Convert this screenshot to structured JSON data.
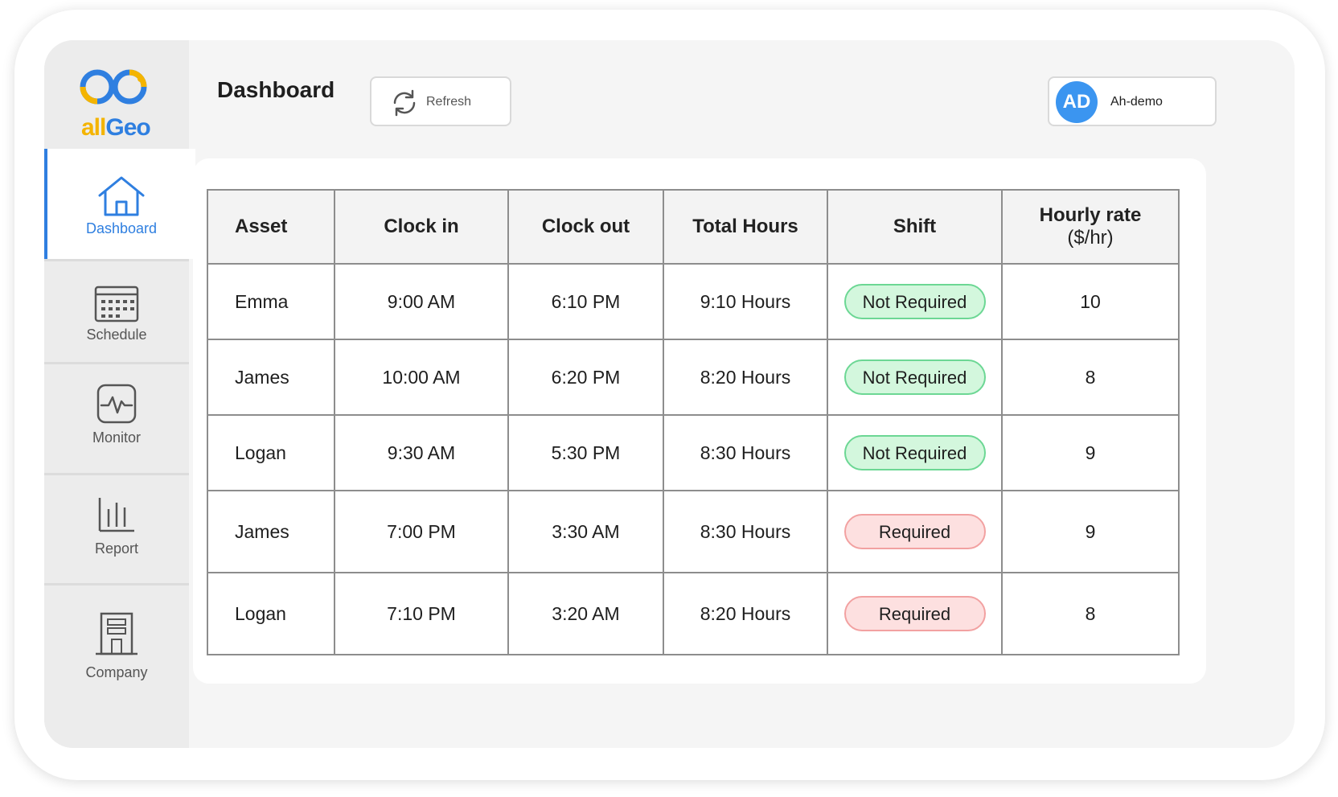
{
  "app": {
    "logo": {
      "part1": "all",
      "part2": "Geo"
    },
    "page_title": "Dashboard",
    "refresh_label": "Refresh",
    "user": {
      "initials": "AD",
      "name": "Ah-demo"
    }
  },
  "sidebar": {
    "items": [
      {
        "label": "Dashboard",
        "icon": "home-icon",
        "active": true
      },
      {
        "label": "Schedule",
        "icon": "calendar-icon",
        "active": false
      },
      {
        "label": "Monitor",
        "icon": "pulse-icon",
        "active": false
      },
      {
        "label": "Report",
        "icon": "bar-chart-icon",
        "active": false
      },
      {
        "label": "Company",
        "icon": "building-icon",
        "active": false
      }
    ]
  },
  "table": {
    "headers": [
      "Asset",
      "Clock in",
      "Clock out",
      "Total Hours",
      "Shift",
      "Hourly rate",
      "($/hr)"
    ],
    "rows": [
      {
        "asset": "Emma",
        "clock_in": "9:00 AM",
        "clock_out": "6:10 PM",
        "total": "9:10 Hours",
        "shift": "Not Required",
        "rate": "10"
      },
      {
        "asset": "James",
        "clock_in": "10:00 AM",
        "clock_out": "6:20 PM",
        "total": "8:20 Hours",
        "shift": "Not Required",
        "rate": "8"
      },
      {
        "asset": "Logan",
        "clock_in": "9:30 AM",
        "clock_out": "5:30 PM",
        "total": "8:30 Hours",
        "shift": "Not Required",
        "rate": "9"
      },
      {
        "asset": "James",
        "clock_in": "7:00 PM",
        "clock_out": "3:30 AM",
        "total": "8:30 Hours",
        "shift": "Required",
        "rate": "9"
      },
      {
        "asset": "Logan",
        "clock_in": "7:10 PM",
        "clock_out": "3:20 AM",
        "total": "8:20 Hours",
        "shift": "Required",
        "rate": "8"
      }
    ]
  },
  "colors": {
    "accent": "#2f7fe0",
    "logo_yellow": "#f4b400",
    "pill_green_bg": "#d3f7dd",
    "pill_red_bg": "#fde0e0"
  }
}
